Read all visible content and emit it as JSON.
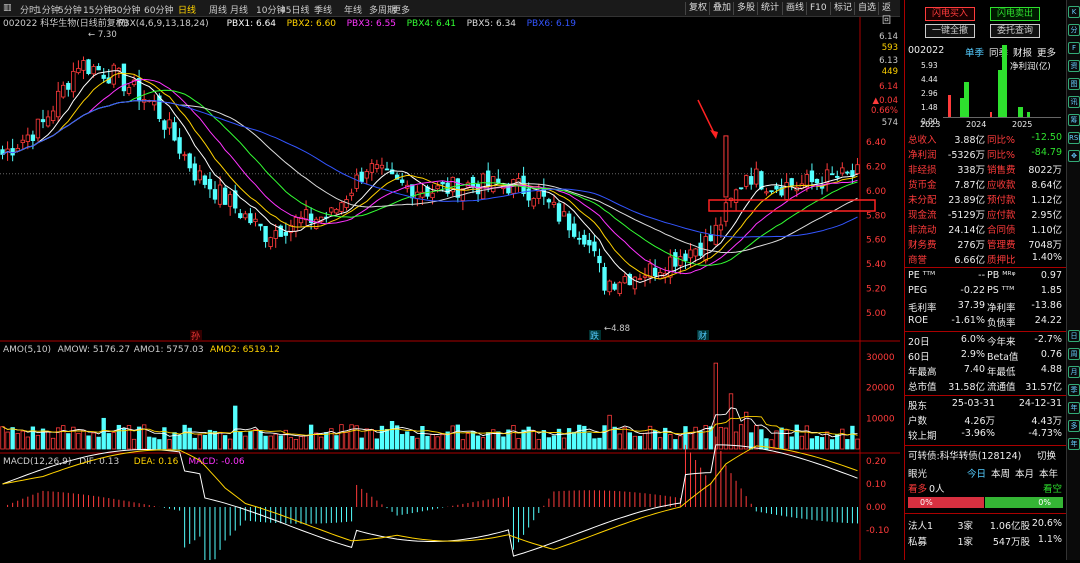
{
  "toolbar": {
    "timeframes": [
      "分时",
      "1分钟",
      "5分钟",
      "15分钟",
      "30分钟",
      "60分钟",
      "日线",
      "周线",
      "月线",
      "10分钟",
      "45日线",
      "季线",
      "年线",
      "多周期",
      "更多"
    ],
    "active_index": 6,
    "buttons": [
      "复权",
      "叠加",
      "多股",
      "统计",
      "画线",
      "F10",
      "标记",
      "自选",
      "返回"
    ]
  },
  "header": {
    "stock": "002022 科华生物(日线前复权)",
    "ind": [
      {
        "t": "PBX(4,6,9,13,18,24)",
        "c": "#ccc"
      },
      {
        "t": "PBX1: 6.64",
        "c": "#fff"
      },
      {
        "t": "PBX2: 6.60",
        "c": "#ffd200"
      },
      {
        "t": "PBX3: 6.55",
        "c": "#ff33ff"
      },
      {
        "t": "PBX4: 6.41",
        "c": "#33ff33"
      },
      {
        "t": "PBX5: 6.34",
        "c": "#ddd"
      },
      {
        "t": "PBX6: 6.19",
        "c": "#3355ff"
      }
    ]
  },
  "main_axis": {
    "ticks": [
      "6.40",
      "6.20",
      "6.00",
      "5.80",
      "5.60",
      "5.40",
      "5.20",
      "5.00"
    ],
    "top_labels": [
      {
        "t": "6.14",
        "c": "#ccc"
      },
      {
        "t": "593",
        "c": "#ffd200"
      },
      {
        "t": "6.13",
        "c": "#ccc"
      },
      {
        "t": "449",
        "c": "#ffd200"
      },
      {
        "t": "6.14",
        "c": "#ff3b3b"
      },
      {
        "t": "▲0.04",
        "c": "#ff3b3b"
      },
      {
        "t": "0.66%",
        "c": "#ff3b3b"
      },
      {
        "t": "574",
        "c": "#ccc"
      }
    ],
    "high_label": "7.30",
    "low_label": "4.88",
    "markers": [
      "孙",
      "跌",
      "财"
    ]
  },
  "amo": {
    "header": [
      {
        "t": "AMO(5,10)",
        "c": "#ccc"
      },
      {
        "t": "AMOW: 5176.27",
        "c": "#ccc"
      },
      {
        "t": "AMO1: 5757.03",
        "c": "#ccc"
      },
      {
        "t": "AMO2: 6519.12",
        "c": "#ffd200"
      }
    ],
    "ticks": [
      "30000",
      "20000",
      "10000"
    ]
  },
  "macd": {
    "header": [
      {
        "t": "MACD(12,26,9)",
        "c": "#ccc"
      },
      {
        "t": "DIF: 0.13",
        "c": "#ccc"
      },
      {
        "t": "DEA: 0.16",
        "c": "#ffd200"
      },
      {
        "t": "MACD: -0.06",
        "c": "#ff33ff"
      }
    ],
    "ticks": [
      "0.20",
      "0.10",
      "0.00",
      "-0.10"
    ]
  },
  "panel": {
    "sell_btn": "闪电买入",
    "buy_btn": "闪电卖出",
    "cancel_btn": "一键全撤",
    "order_btn": "委托查询",
    "code": "002022",
    "tabs": [
      "单季",
      "同季",
      "财报",
      "更多"
    ],
    "profit_label": "净利润(亿)",
    "bar_axis": [
      "5.93",
      "4.44",
      "2.96",
      "1.48",
      "0.00"
    ],
    "years": [
      "2023",
      "2024",
      "2025"
    ],
    "fin": [
      {
        "l": "总收入",
        "v": "3.88亿",
        "l2": "同比%",
        "v2": "-12.50",
        "c2": "grn"
      },
      {
        "l": "净利润",
        "v": "-5326万",
        "l2": "同比%",
        "v2": "-84.79",
        "c2": "grn"
      },
      {
        "l": "非经损",
        "v": "338万",
        "l2": "销售费",
        "v2": "8022万",
        "c2": "wht"
      },
      {
        "l": "货币金",
        "v": "7.87亿",
        "l2": "应收款",
        "v2": "8.64亿",
        "c2": "wht"
      },
      {
        "l": "未分配",
        "v": "23.89亿",
        "l2": "预付款",
        "v2": "1.12亿",
        "c2": "wht"
      },
      {
        "l": "现金流",
        "v": "-5129万",
        "l2": "应付款",
        "v2": "2.95亿",
        "c2": "wht"
      },
      {
        "l": "非流动",
        "v": "24.14亿",
        "l2": "合同债",
        "v2": "1.10亿",
        "c2": "wht"
      },
      {
        "l": "财务费",
        "v": "276万",
        "l2": "管理费",
        "v2": "7048万",
        "c2": "wht"
      },
      {
        "l": "商誉",
        "v": "6.66亿",
        "l2": "质押比",
        "v2": "1.40%",
        "c2": "wht"
      }
    ],
    "val": [
      {
        "l": "PE ᵀᵀᴹ",
        "v": "--",
        "l2": "PB ᴹᴿᵠ",
        "v2": "0.97"
      },
      {
        "l": "PEG",
        "v": "-0.22",
        "l2": "PS ᵀᵀᴹ",
        "v2": "1.85"
      },
      {
        "l": "毛利率",
        "v": "37.39",
        "l2": "净利率",
        "v2": "-13.86"
      },
      {
        "l": "ROE",
        "v": "-1.61%",
        "l2": "负债率",
        "v2": "24.22"
      }
    ],
    "perf": [
      {
        "l": "20日",
        "v": "6.0%",
        "l2": "今年来",
        "v2": "-2.7%"
      },
      {
        "l": "60日",
        "v": "2.9%",
        "l2": "Beta值",
        "v2": "0.76"
      },
      {
        "l": "年最高",
        "v": "7.40",
        "l2": "年最低",
        "v2": "4.88"
      },
      {
        "l": "总市值",
        "v": "31.58亿",
        "l2": "流通值",
        "v2": "31.57亿"
      }
    ],
    "holders": [
      {
        "l": "股东",
        "v": "25-03-31",
        "v2": "24-12-31"
      },
      {
        "l": "户数",
        "v": "4.26万",
        "v2": "4.43万"
      },
      {
        "l": "较上期",
        "v": "-3.96%",
        "v2": "-4.73%"
      }
    ],
    "bond": "可转债:科华转债(128124)",
    "bond_switch": "切换",
    "sentiment": "眼光",
    "sent_tabs": [
      "今日",
      "本周",
      "本月",
      "本年"
    ],
    "long_label": "看多",
    "long_count": "0人",
    "short_label": "看空",
    "long_pct": "0%",
    "short_pct": "0%",
    "inst": [
      {
        "l": "法人1",
        "v": "3家",
        "v2": "1.06亿股",
        "v3": "20.6%"
      },
      {
        "l": "私募",
        "v": "1家",
        "v2": "547万股",
        "v3": "1.1%"
      }
    ]
  },
  "icons": [
    "K",
    "分",
    "F",
    "资",
    "图",
    "讯",
    "筹",
    "RSI",
    "✥",
    "日",
    "周",
    "月",
    "季",
    "年",
    "多",
    "年"
  ],
  "colors": {
    "up": "#ff3b3b",
    "down": "#54ffff",
    "highlight_box": "#ff2222",
    "arrow": "#ff2222"
  }
}
